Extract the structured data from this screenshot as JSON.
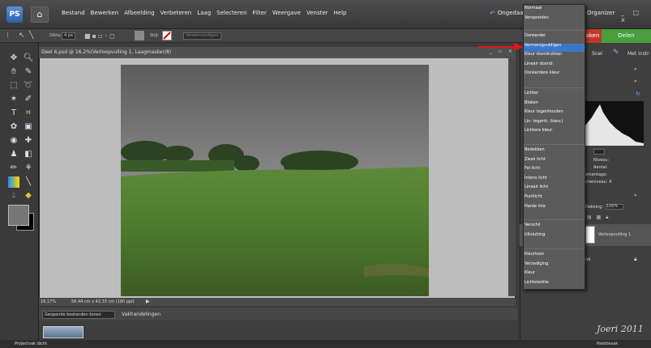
{
  "menubar": {
    "logo_text": "PS",
    "items": [
      "Bestand",
      "Bewerken",
      "Afbeelding",
      "Verbeteren",
      "Laag",
      "Selecteren",
      "Filter",
      "Weergave",
      "Venster",
      "Help"
    ],
    "undo_label": "Ongedaa",
    "organizer_label": "Organizer",
    "window_controls": "_ □ x"
  },
  "options_bar": {
    "size_label": "Dikte:",
    "size_value": "4 px",
    "style_label": "Stijl:",
    "simplify_button": "Vereenvoudigen"
  },
  "mode_tabs": {
    "make": "aken",
    "share": "Delen"
  },
  "document": {
    "title": "Deel 6.psd @ 16,2%(Verloopvulling 1, Laagmasker/8)",
    "zoom": "16,17%",
    "dimensions": "56,44 cm x 42,33 cm (180 ppi)"
  },
  "project_bin": {
    "select_value": "Geopende bestanden tonen",
    "actions_label": "Vakhandelingen"
  },
  "bottombar": {
    "left": "Projectvak dicht",
    "right": "Palettevak"
  },
  "panel": {
    "snel": "Snel",
    "met_instr": "Met instr",
    "hist_labels": [
      "Niveau:",
      "Aantal:",
      "ercentage:",
      "cheniveau: 4"
    ],
    "opacity_label": "Dekking:",
    "opacity_value": "100%",
    "layer_name": "Verloopvulling 1",
    "layer_name_2": "nd"
  },
  "blend_dropdown": {
    "groups": [
      [
        "Normaal",
        "Verspreiden"
      ],
      [
        "Donkerder",
        "Vermenigvuldigen",
        "Kleur doordrukken",
        "Lineair doordr.",
        "Donkerdere kleur"
      ],
      [
        "Lichter",
        "Bleken",
        "Kleur tegenhouden",
        "Lin. tegenh. (toev.)",
        "Lichtere kleur"
      ],
      [
        "Bedekken",
        "Zwak licht",
        "Fel licht",
        "Intens licht",
        "Lineair licht",
        "Puntlicht",
        "Harde mix"
      ],
      [
        "Verschil",
        "Uitsluiting"
      ],
      [
        "Kleurtoon",
        "Verzadiging",
        "Kleur",
        "Lichtsterkte"
      ]
    ],
    "selected": "Vermenigvuldigen",
    "highlight_color": "#3d78c8"
  },
  "signature": "Joeri 2011",
  "colors": {
    "accent_red": "#c0392b",
    "accent_green": "#4a9e3e"
  }
}
